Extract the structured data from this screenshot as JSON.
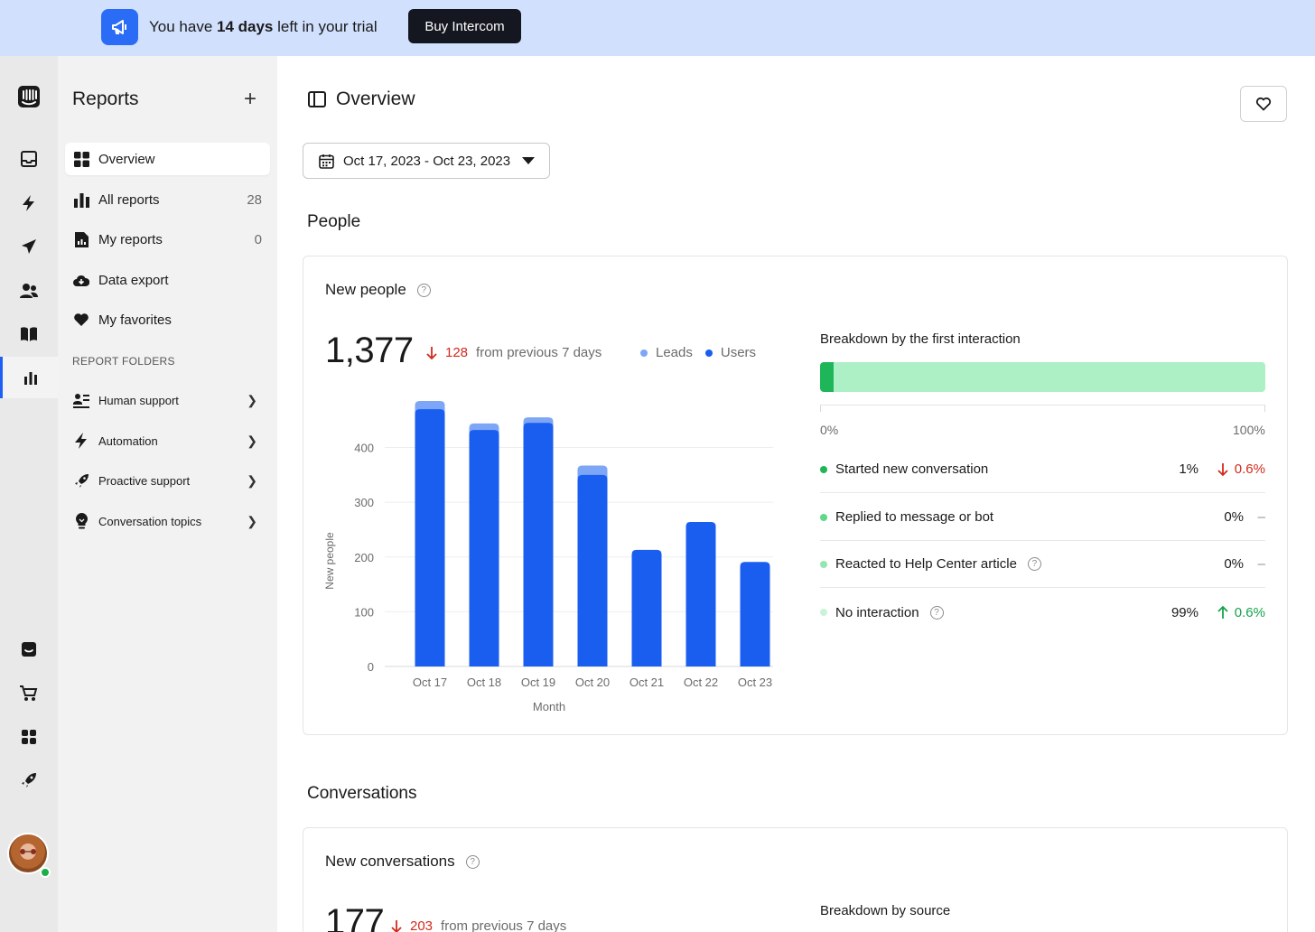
{
  "banner": {
    "text_before": "You have ",
    "text_bold": "14 days",
    "text_after": " left in your trial",
    "button": "Buy Intercom"
  },
  "sidebar": {
    "title": "Reports",
    "add": "+",
    "items": [
      {
        "label": "Overview",
        "icon": "grid-icon",
        "count": ""
      },
      {
        "label": "All reports",
        "icon": "bar-chart-icon",
        "count": "28"
      },
      {
        "label": "My reports",
        "icon": "report-doc-icon",
        "count": "0"
      },
      {
        "label": "Data export",
        "icon": "cloud-download-icon",
        "count": ""
      },
      {
        "label": "My favorites",
        "icon": "heart-icon",
        "count": ""
      }
    ],
    "section": "REPORT FOLDERS",
    "folders": [
      {
        "label": "Human support",
        "icon": "people-list-icon"
      },
      {
        "label": "Automation",
        "icon": "bolt-icon"
      },
      {
        "label": "Proactive support",
        "icon": "rocket-icon"
      },
      {
        "label": "Conversation topics",
        "icon": "lightbulb-icon"
      }
    ]
  },
  "main": {
    "title": "Overview",
    "date_range": "Oct 17, 2023 - Oct 23, 2023",
    "people_heading": "People",
    "conversations_heading": "Conversations",
    "new_people": {
      "title": "New people",
      "total": "1,377",
      "delta": "128",
      "delta_text": "from previous 7 days",
      "legend_leads": "Leads",
      "legend_users": "Users"
    },
    "breakdown": {
      "title": "Breakdown by the first interaction",
      "fill_fraction": 0.03,
      "label_min": "0%",
      "label_max": "100%",
      "rows": [
        {
          "label": "Started new conversation",
          "pct": "1%",
          "change": "0.6%",
          "dir": "down",
          "color": "#1fb65a",
          "help": false
        },
        {
          "label": "Replied to message or bot",
          "pct": "0%",
          "change": "–",
          "dir": "none",
          "color": "#5fd88a",
          "help": false
        },
        {
          "label": "Reacted to Help Center article",
          "pct": "0%",
          "change": "–",
          "dir": "none",
          "color": "#94e6b0",
          "help": true
        },
        {
          "label": "No interaction",
          "pct": "99%",
          "change": "0.6%",
          "dir": "up",
          "color": "#c9f3d7",
          "help": true
        }
      ]
    },
    "new_conversations": {
      "title": "New conversations",
      "total": "177",
      "delta": "203",
      "delta_text": "from previous 7 days",
      "breakdown_title": "Breakdown by source"
    }
  },
  "colors": {
    "accent": "#1f5ff5",
    "users": "#1a5ef0",
    "leads": "#7ea6f6",
    "down": "#d12a1c",
    "up": "#14a34a"
  },
  "chart_data": {
    "type": "bar",
    "stacked": true,
    "categories": [
      "Oct 17",
      "Oct 18",
      "Oct 19",
      "Oct 20",
      "Oct 21",
      "Oct 22",
      "Oct 23"
    ],
    "series": [
      {
        "name": "Users",
        "values": [
          470,
          432,
          445,
          350,
          213,
          264,
          191
        ]
      },
      {
        "name": "Leads",
        "values": [
          15,
          12,
          10,
          17,
          0,
          0,
          0
        ]
      }
    ],
    "xlabel": "Month",
    "ylabel": "New people",
    "yticks": [
      0,
      100,
      200,
      300,
      400
    ],
    "ylim": [
      0,
      485
    ],
    "grid": true
  }
}
